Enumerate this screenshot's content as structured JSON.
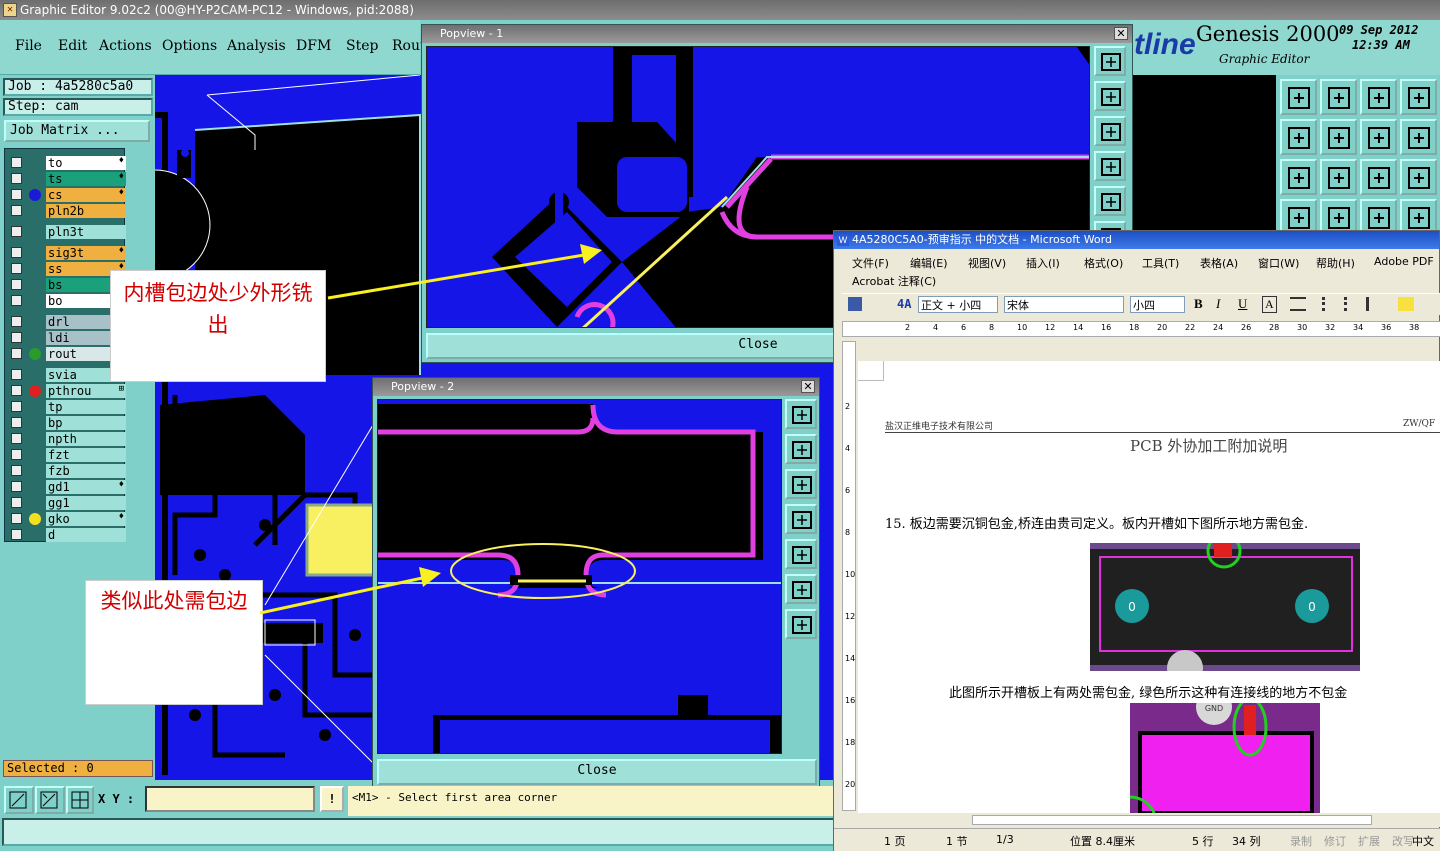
{
  "app": {
    "title": "Graphic Editor 9.02c2 (00@HY-P2CAM-PC12 - Windows, pid:2088)"
  },
  "menu": [
    "File",
    "Edit",
    "Actions",
    "Options",
    "Analysis",
    "DFM",
    "Step",
    "Rout"
  ],
  "brand": {
    "logo": "tline",
    "product": "Genesis 2000",
    "subtitle": "Graphic Editor",
    "date": "09 Sep 2012",
    "time": "12:39 AM"
  },
  "job": {
    "job": "Job : 4a5280c5a0",
    "step": "Step: cam",
    "matrix_button": "Job Matrix ..."
  },
  "layers": [
    {
      "name": "to",
      "color": "#ffffff",
      "dot": "",
      "mark": "♦"
    },
    {
      "name": "ts",
      "color": "#1aa07a",
      "dot": "",
      "mark": "♦"
    },
    {
      "name": "cs",
      "color": "#f0b040",
      "dot": "#1a1ad8",
      "mark": "♦"
    },
    {
      "name": "pln2b",
      "color": "#f0b040",
      "dot": "",
      "mark": ""
    },
    {
      "name": "pln3t",
      "color": "#9fe0d8",
      "dot": "",
      "mark": ""
    },
    {
      "name": "sig3t",
      "color": "#f0b040",
      "dot": "",
      "mark": "♦"
    },
    {
      "name": "ss",
      "color": "#f0b040",
      "dot": "",
      "mark": "♦"
    },
    {
      "name": "bs",
      "color": "#1aa07a",
      "dot": "",
      "mark": ""
    },
    {
      "name": "bo",
      "color": "#ffffff",
      "dot": "",
      "mark": ""
    },
    {
      "name": "drl",
      "color": "#a8c0c8",
      "dot": "",
      "mark": ""
    },
    {
      "name": "ldi",
      "color": "#a8c0c8",
      "dot": "",
      "mark": ""
    },
    {
      "name": "rout",
      "color": "#d8e8e8",
      "dot": "#2a9a2a",
      "mark": ""
    },
    {
      "name": "svia",
      "color": "#9fe0d8",
      "dot": "",
      "mark": ""
    },
    {
      "name": "pthrou",
      "color": "#9fe0d8",
      "dot": "#e02020",
      "mark": "⊞"
    },
    {
      "name": "tp",
      "color": "#9fe0d8",
      "dot": "",
      "mark": ""
    },
    {
      "name": "bp",
      "color": "#9fe0d8",
      "dot": "",
      "mark": ""
    },
    {
      "name": "npth",
      "color": "#9fe0d8",
      "dot": "",
      "mark": ""
    },
    {
      "name": "fzt",
      "color": "#9fe0d8",
      "dot": "",
      "mark": ""
    },
    {
      "name": "fzb",
      "color": "#9fe0d8",
      "dot": "",
      "mark": ""
    },
    {
      "name": "gd1",
      "color": "#9fe0d8",
      "dot": "",
      "mark": "♦"
    },
    {
      "name": "gg1",
      "color": "#9fe0d8",
      "dot": "",
      "mark": ""
    },
    {
      "name": "gko",
      "color": "#9fe0d8",
      "dot": "#f0e020",
      "mark": "♦"
    },
    {
      "name": "d",
      "color": "#9fe0d8",
      "dot": "",
      "mark": ""
    }
  ],
  "selected": "Selected : 0",
  "status": {
    "xy_label": "X Y :",
    "xy_value": "",
    "message": "<M1> - Select first area corner"
  },
  "popview1": {
    "title": "Popview - 1",
    "close": "Close"
  },
  "popview2": {
    "title": "Popview - 2",
    "close": "Close"
  },
  "callouts": {
    "a": "内槽包边处少外形铣出",
    "b": "类似此处需包边"
  },
  "word": {
    "title": "4A5280C5A0-预审指示 中的文档 - Microsoft Word",
    "menu": [
      "文件(F)",
      "编辑(E)",
      "视图(V)",
      "插入(I)",
      "格式(O)",
      "工具(T)",
      "表格(A)",
      "窗口(W)",
      "帮助(H)",
      "Adobe PDF"
    ],
    "menu2": "Acrobat 注释(C)",
    "style": "正文 + 小四",
    "font": "宋体",
    "size": "小四",
    "ruler": [
      "2",
      "4",
      "6",
      "8",
      "10",
      "12",
      "14",
      "16",
      "18",
      "20",
      "22",
      "24",
      "26",
      "28",
      "30",
      "32",
      "34",
      "36",
      "38"
    ],
    "vruler": [
      "2",
      "4",
      "6",
      "8",
      "10",
      "12",
      "14",
      "16",
      "18",
      "20"
    ],
    "header_company": "盐汉正维电子技术有限公司",
    "header_code": "ZW/QF",
    "doc_title": "PCB 外协加工附加说明",
    "para15": "15. 板边需要沉铜包金,桥连由贵司定义。板内开槽如下图所示地方需包金.",
    "para2": "此图所示开槽板上有两处需包金, 绿色所示这种有连接线的地方不包金",
    "pad": "0",
    "gnd": "GND",
    "status": [
      "1 页",
      "1 节",
      "1/3",
      "位置 8.4厘米",
      "5 行",
      "34 列",
      "录制",
      "修订",
      "扩展",
      "改写",
      "中文"
    ]
  }
}
